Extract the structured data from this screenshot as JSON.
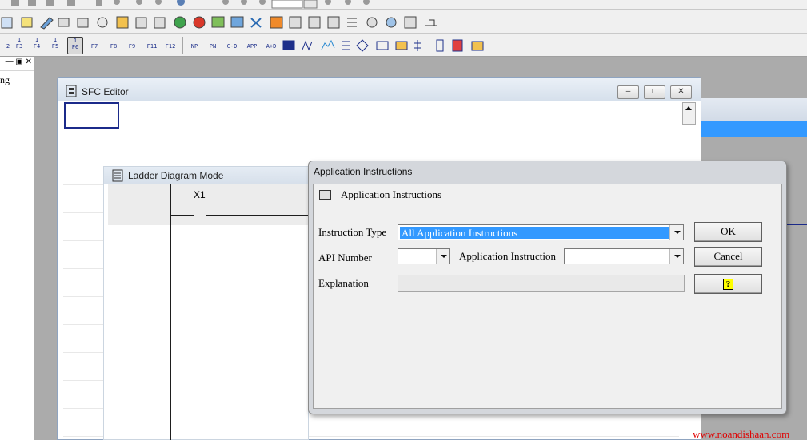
{
  "toolbar_row3": {
    "keys": [
      [
        "2",
        ""
      ],
      [
        "F3",
        "1"
      ],
      [
        "F4",
        "1"
      ],
      [
        "F5",
        "1"
      ],
      [
        "F6",
        "1"
      ],
      [
        "F7",
        ""
      ],
      [
        "F8",
        ""
      ],
      [
        "F9",
        ""
      ],
      [
        "F11",
        ""
      ],
      [
        "F12",
        ""
      ],
      [
        "NP",
        ""
      ],
      [
        "PN",
        ""
      ],
      [
        "C-D",
        ""
      ],
      [
        "APP",
        ""
      ],
      [
        "A+D",
        ""
      ]
    ]
  },
  "left_panel": {
    "controls": "— ▣ ✕",
    "item": "ng"
  },
  "sfc_window": {
    "title": "SFC Editor",
    "min": "–",
    "max": "□",
    "close": "✕"
  },
  "ladder_window": {
    "title": "Ladder Diagram Mode",
    "contact_label": "X1"
  },
  "dialog": {
    "title": "Application Instructions",
    "subtitle": "Application Instructions",
    "instruction_type_label": "Instruction Type",
    "instruction_type_value": "All Application Instructions",
    "api_number_label": "API Number",
    "api_number_value": "",
    "application_instruction_label": "Application Instruction",
    "application_instruction_value": "",
    "explanation_label": "Explanation",
    "explanation_value": "",
    "ok_label": "OK",
    "cancel_label": "Cancel",
    "help_label": "?"
  },
  "watermark": "www.noandishaan.com"
}
